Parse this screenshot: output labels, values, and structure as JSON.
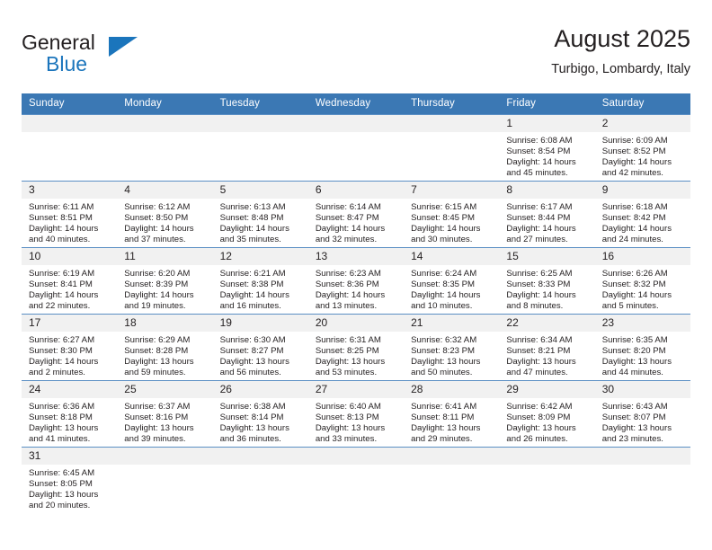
{
  "brand": {
    "name_top": "General",
    "name_bottom": "Blue",
    "accent_color": "#1b75bc",
    "triangle_icon": "triangle-icon"
  },
  "header": {
    "title": "August 2025",
    "location": "Turbigo, Lombardy, Italy"
  },
  "theme": {
    "header_blue": "#3b78b4",
    "daynum_band": "#f1f1f1",
    "text": "#231f20"
  },
  "calendar": {
    "weekday_headers": [
      "Sunday",
      "Monday",
      "Tuesday",
      "Wednesday",
      "Thursday",
      "Friday",
      "Saturday"
    ],
    "weeks": [
      [
        {
          "day": "",
          "blank": true,
          "sunrise": "",
          "sunset": "",
          "daylight_l1": "",
          "daylight_l2": ""
        },
        {
          "day": "",
          "blank": true,
          "sunrise": "",
          "sunset": "",
          "daylight_l1": "",
          "daylight_l2": ""
        },
        {
          "day": "",
          "blank": true,
          "sunrise": "",
          "sunset": "",
          "daylight_l1": "",
          "daylight_l2": ""
        },
        {
          "day": "",
          "blank": true,
          "sunrise": "",
          "sunset": "",
          "daylight_l1": "",
          "daylight_l2": ""
        },
        {
          "day": "",
          "blank": true,
          "sunrise": "",
          "sunset": "",
          "daylight_l1": "",
          "daylight_l2": ""
        },
        {
          "day": "1",
          "blank": false,
          "sunrise": "Sunrise: 6:08 AM",
          "sunset": "Sunset: 8:54 PM",
          "daylight_l1": "Daylight: 14 hours",
          "daylight_l2": "and 45 minutes."
        },
        {
          "day": "2",
          "blank": false,
          "sunrise": "Sunrise: 6:09 AM",
          "sunset": "Sunset: 8:52 PM",
          "daylight_l1": "Daylight: 14 hours",
          "daylight_l2": "and 42 minutes."
        }
      ],
      [
        {
          "day": "3",
          "blank": false,
          "sunrise": "Sunrise: 6:11 AM",
          "sunset": "Sunset: 8:51 PM",
          "daylight_l1": "Daylight: 14 hours",
          "daylight_l2": "and 40 minutes."
        },
        {
          "day": "4",
          "blank": false,
          "sunrise": "Sunrise: 6:12 AM",
          "sunset": "Sunset: 8:50 PM",
          "daylight_l1": "Daylight: 14 hours",
          "daylight_l2": "and 37 minutes."
        },
        {
          "day": "5",
          "blank": false,
          "sunrise": "Sunrise: 6:13 AM",
          "sunset": "Sunset: 8:48 PM",
          "daylight_l1": "Daylight: 14 hours",
          "daylight_l2": "and 35 minutes."
        },
        {
          "day": "6",
          "blank": false,
          "sunrise": "Sunrise: 6:14 AM",
          "sunset": "Sunset: 8:47 PM",
          "daylight_l1": "Daylight: 14 hours",
          "daylight_l2": "and 32 minutes."
        },
        {
          "day": "7",
          "blank": false,
          "sunrise": "Sunrise: 6:15 AM",
          "sunset": "Sunset: 8:45 PM",
          "daylight_l1": "Daylight: 14 hours",
          "daylight_l2": "and 30 minutes."
        },
        {
          "day": "8",
          "blank": false,
          "sunrise": "Sunrise: 6:17 AM",
          "sunset": "Sunset: 8:44 PM",
          "daylight_l1": "Daylight: 14 hours",
          "daylight_l2": "and 27 minutes."
        },
        {
          "day": "9",
          "blank": false,
          "sunrise": "Sunrise: 6:18 AM",
          "sunset": "Sunset: 8:42 PM",
          "daylight_l1": "Daylight: 14 hours",
          "daylight_l2": "and 24 minutes."
        }
      ],
      [
        {
          "day": "10",
          "blank": false,
          "sunrise": "Sunrise: 6:19 AM",
          "sunset": "Sunset: 8:41 PM",
          "daylight_l1": "Daylight: 14 hours",
          "daylight_l2": "and 22 minutes."
        },
        {
          "day": "11",
          "blank": false,
          "sunrise": "Sunrise: 6:20 AM",
          "sunset": "Sunset: 8:39 PM",
          "daylight_l1": "Daylight: 14 hours",
          "daylight_l2": "and 19 minutes."
        },
        {
          "day": "12",
          "blank": false,
          "sunrise": "Sunrise: 6:21 AM",
          "sunset": "Sunset: 8:38 PM",
          "daylight_l1": "Daylight: 14 hours",
          "daylight_l2": "and 16 minutes."
        },
        {
          "day": "13",
          "blank": false,
          "sunrise": "Sunrise: 6:23 AM",
          "sunset": "Sunset: 8:36 PM",
          "daylight_l1": "Daylight: 14 hours",
          "daylight_l2": "and 13 minutes."
        },
        {
          "day": "14",
          "blank": false,
          "sunrise": "Sunrise: 6:24 AM",
          "sunset": "Sunset: 8:35 PM",
          "daylight_l1": "Daylight: 14 hours",
          "daylight_l2": "and 10 minutes."
        },
        {
          "day": "15",
          "blank": false,
          "sunrise": "Sunrise: 6:25 AM",
          "sunset": "Sunset: 8:33 PM",
          "daylight_l1": "Daylight: 14 hours",
          "daylight_l2": "and 8 minutes."
        },
        {
          "day": "16",
          "blank": false,
          "sunrise": "Sunrise: 6:26 AM",
          "sunset": "Sunset: 8:32 PM",
          "daylight_l1": "Daylight: 14 hours",
          "daylight_l2": "and 5 minutes."
        }
      ],
      [
        {
          "day": "17",
          "blank": false,
          "sunrise": "Sunrise: 6:27 AM",
          "sunset": "Sunset: 8:30 PM",
          "daylight_l1": "Daylight: 14 hours",
          "daylight_l2": "and 2 minutes."
        },
        {
          "day": "18",
          "blank": false,
          "sunrise": "Sunrise: 6:29 AM",
          "sunset": "Sunset: 8:28 PM",
          "daylight_l1": "Daylight: 13 hours",
          "daylight_l2": "and 59 minutes."
        },
        {
          "day": "19",
          "blank": false,
          "sunrise": "Sunrise: 6:30 AM",
          "sunset": "Sunset: 8:27 PM",
          "daylight_l1": "Daylight: 13 hours",
          "daylight_l2": "and 56 minutes."
        },
        {
          "day": "20",
          "blank": false,
          "sunrise": "Sunrise: 6:31 AM",
          "sunset": "Sunset: 8:25 PM",
          "daylight_l1": "Daylight: 13 hours",
          "daylight_l2": "and 53 minutes."
        },
        {
          "day": "21",
          "blank": false,
          "sunrise": "Sunrise: 6:32 AM",
          "sunset": "Sunset: 8:23 PM",
          "daylight_l1": "Daylight: 13 hours",
          "daylight_l2": "and 50 minutes."
        },
        {
          "day": "22",
          "blank": false,
          "sunrise": "Sunrise: 6:34 AM",
          "sunset": "Sunset: 8:21 PM",
          "daylight_l1": "Daylight: 13 hours",
          "daylight_l2": "and 47 minutes."
        },
        {
          "day": "23",
          "blank": false,
          "sunrise": "Sunrise: 6:35 AM",
          "sunset": "Sunset: 8:20 PM",
          "daylight_l1": "Daylight: 13 hours",
          "daylight_l2": "and 44 minutes."
        }
      ],
      [
        {
          "day": "24",
          "blank": false,
          "sunrise": "Sunrise: 6:36 AM",
          "sunset": "Sunset: 8:18 PM",
          "daylight_l1": "Daylight: 13 hours",
          "daylight_l2": "and 41 minutes."
        },
        {
          "day": "25",
          "blank": false,
          "sunrise": "Sunrise: 6:37 AM",
          "sunset": "Sunset: 8:16 PM",
          "daylight_l1": "Daylight: 13 hours",
          "daylight_l2": "and 39 minutes."
        },
        {
          "day": "26",
          "blank": false,
          "sunrise": "Sunrise: 6:38 AM",
          "sunset": "Sunset: 8:14 PM",
          "daylight_l1": "Daylight: 13 hours",
          "daylight_l2": "and 36 minutes."
        },
        {
          "day": "27",
          "blank": false,
          "sunrise": "Sunrise: 6:40 AM",
          "sunset": "Sunset: 8:13 PM",
          "daylight_l1": "Daylight: 13 hours",
          "daylight_l2": "and 33 minutes."
        },
        {
          "day": "28",
          "blank": false,
          "sunrise": "Sunrise: 6:41 AM",
          "sunset": "Sunset: 8:11 PM",
          "daylight_l1": "Daylight: 13 hours",
          "daylight_l2": "and 29 minutes."
        },
        {
          "day": "29",
          "blank": false,
          "sunrise": "Sunrise: 6:42 AM",
          "sunset": "Sunset: 8:09 PM",
          "daylight_l1": "Daylight: 13 hours",
          "daylight_l2": "and 26 minutes."
        },
        {
          "day": "30",
          "blank": false,
          "sunrise": "Sunrise: 6:43 AM",
          "sunset": "Sunset: 8:07 PM",
          "daylight_l1": "Daylight: 13 hours",
          "daylight_l2": "and 23 minutes."
        }
      ],
      [
        {
          "day": "31",
          "blank": false,
          "sunrise": "Sunrise: 6:45 AM",
          "sunset": "Sunset: 8:05 PM",
          "daylight_l1": "Daylight: 13 hours",
          "daylight_l2": "and 20 minutes."
        },
        {
          "day": "",
          "blank": true,
          "sunrise": "",
          "sunset": "",
          "daylight_l1": "",
          "daylight_l2": ""
        },
        {
          "day": "",
          "blank": true,
          "sunrise": "",
          "sunset": "",
          "daylight_l1": "",
          "daylight_l2": ""
        },
        {
          "day": "",
          "blank": true,
          "sunrise": "",
          "sunset": "",
          "daylight_l1": "",
          "daylight_l2": ""
        },
        {
          "day": "",
          "blank": true,
          "sunrise": "",
          "sunset": "",
          "daylight_l1": "",
          "daylight_l2": ""
        },
        {
          "day": "",
          "blank": true,
          "sunrise": "",
          "sunset": "",
          "daylight_l1": "",
          "daylight_l2": ""
        },
        {
          "day": "",
          "blank": true,
          "sunrise": "",
          "sunset": "",
          "daylight_l1": "",
          "daylight_l2": ""
        }
      ]
    ]
  }
}
